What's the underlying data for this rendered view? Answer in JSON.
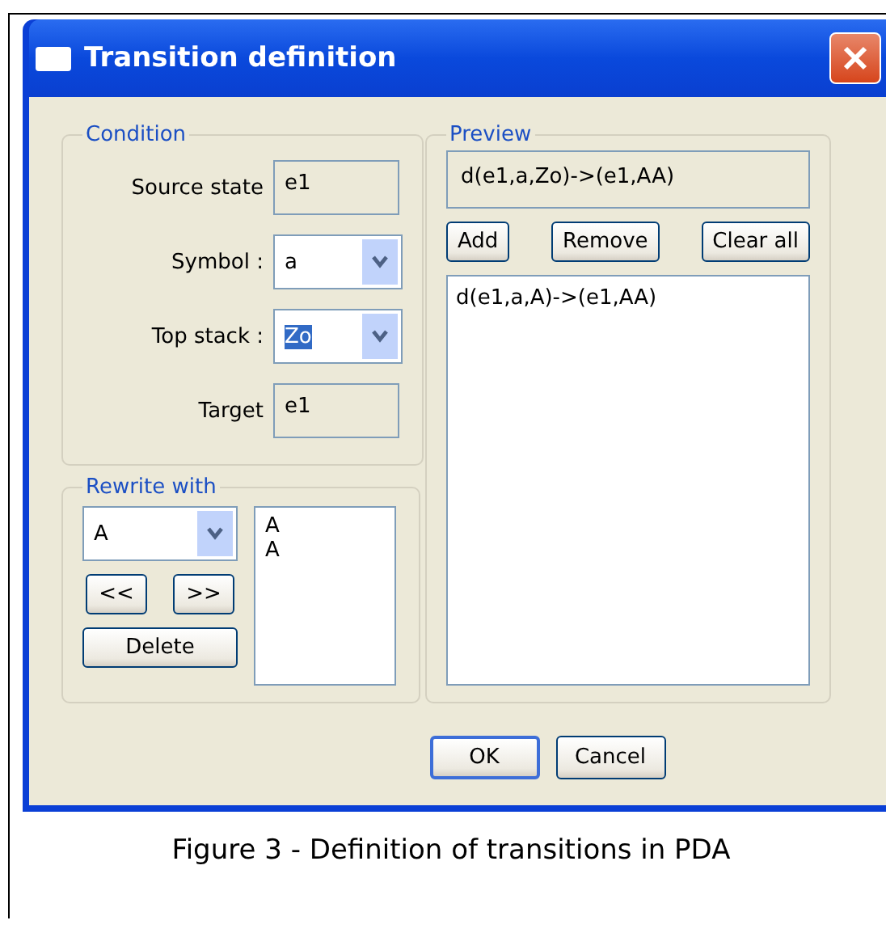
{
  "window": {
    "title": "Transition definition"
  },
  "condition": {
    "legend": "Condition",
    "fields": [
      {
        "kind": "readonly",
        "label": "Source state",
        "value": "e1",
        "highlighted": false
      },
      {
        "kind": "combo",
        "label": "Symbol :",
        "value": "a",
        "highlighted": false
      },
      {
        "kind": "combo",
        "label": "Top stack :",
        "value": "Zo",
        "highlighted": true
      },
      {
        "kind": "readonly",
        "label": "Target",
        "value": "e1",
        "highlighted": false
      }
    ]
  },
  "rewrite": {
    "legend": "Rewrite with",
    "combo_value": "A",
    "buttons": [
      "<<",
      ">>"
    ],
    "delete_button": "Delete",
    "stack_items": [
      "A",
      "A"
    ]
  },
  "preview": {
    "legend": "Preview",
    "expression": "d(e1,a,Zo)->(e1,AA)",
    "buttons": [
      "Add",
      "Remove",
      "Clear all"
    ],
    "transitions": [
      "d(e1,a,A)->(e1,AA)"
    ]
  },
  "dialog_buttons": [
    {
      "label": "OK",
      "default": true
    },
    {
      "label": "Cancel",
      "default": false
    }
  ],
  "caption": "Figure 3 - Definition of transitions in PDA"
}
